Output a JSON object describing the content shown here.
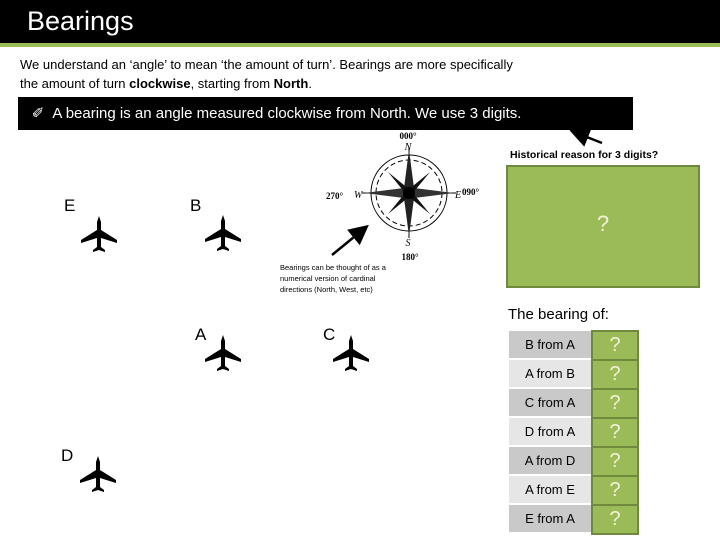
{
  "header": {
    "title": "Bearings"
  },
  "intro": {
    "line1": "We understand an ‘angle’ to mean ‘the amount of turn’. Bearings are more specifically",
    "line2_prefix": "the amount of turn ",
    "line2_bold1": "clockwise",
    "line2_mid": ", starting from ",
    "line2_bold2": "North",
    "line2_suffix": "."
  },
  "banner": {
    "icon": "✐",
    "text": "A bearing is an angle measured clockwise from North. We use 3 digits."
  },
  "compass": {
    "north_label": "000°",
    "east_label": "090°",
    "south_label": "180°",
    "west_label": "270°",
    "n": "N",
    "e": "E",
    "s": "S",
    "w": "W"
  },
  "compass_note": "Bearings can be thought of as a numerical version of cardinal directions (North, West, etc)",
  "historical": {
    "label": "Historical reason for 3 digits?",
    "answer": "?"
  },
  "planes": [
    {
      "label": "E"
    },
    {
      "label": "B"
    },
    {
      "label": "A"
    },
    {
      "label": "C"
    },
    {
      "label": "D"
    }
  ],
  "bearing_table": {
    "title": "The bearing of:",
    "rows": [
      {
        "label": "B from A",
        "answer": "?"
      },
      {
        "label": "A from B",
        "answer": "?"
      },
      {
        "label": "C from A",
        "answer": "?"
      },
      {
        "label": "D from A",
        "answer": "?"
      },
      {
        "label": "A from D",
        "answer": "?"
      },
      {
        "label": "A from E",
        "answer": "?"
      },
      {
        "label": "E from A",
        "answer": "?"
      }
    ]
  },
  "colors": {
    "accent_green": "#9bbb59",
    "green_border": "#71893f",
    "header_bg": "#000000"
  }
}
